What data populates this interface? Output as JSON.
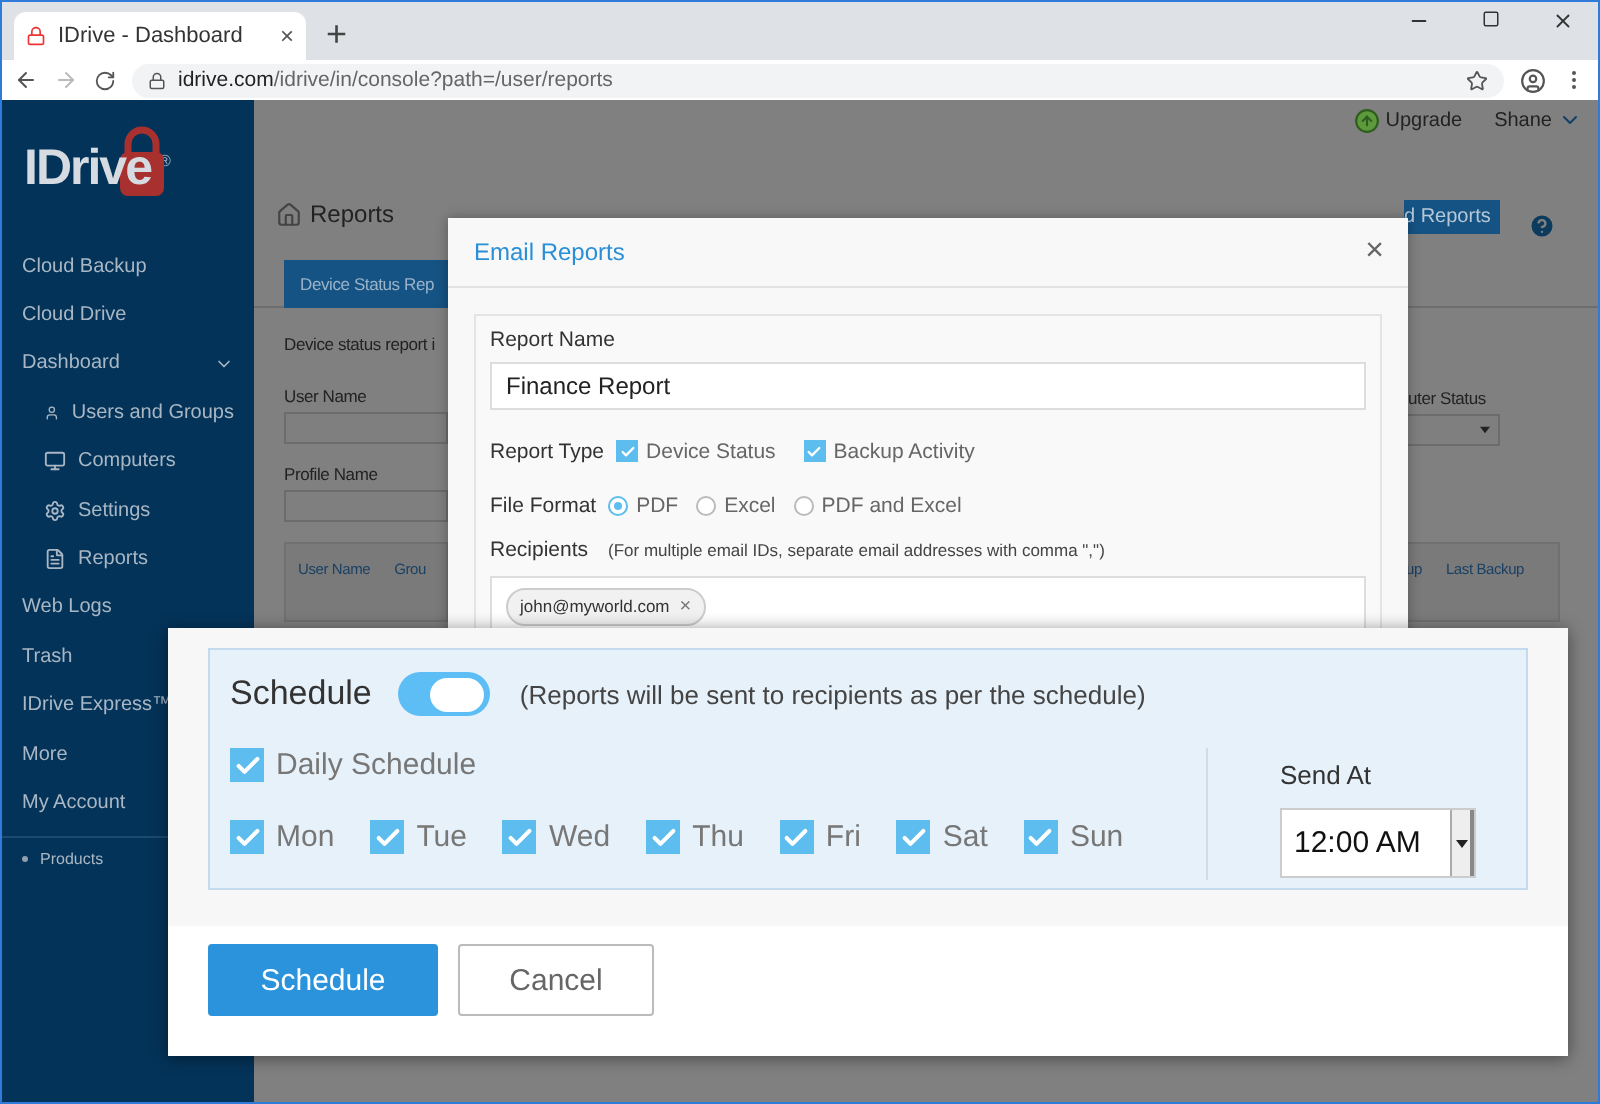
{
  "browser": {
    "tab": {
      "title": "IDrive - Dashboard",
      "close": "×"
    },
    "new_tab": "+",
    "url": {
      "host": "idrive.com",
      "path": "/idrive/in/console?path=/user/reports"
    }
  },
  "sidebar": {
    "logo": {
      "text": "IDrive",
      "mark": "®"
    },
    "items": [
      {
        "label": "Cloud Backup"
      },
      {
        "label": "Cloud Drive"
      },
      {
        "label": "Dashboard",
        "expanded": true,
        "children": [
          {
            "label": "Users and Groups"
          },
          {
            "label": "Computers"
          },
          {
            "label": "Settings"
          },
          {
            "label": "Reports"
          }
        ]
      },
      {
        "label": "Web Logs"
      },
      {
        "label": "Trash"
      },
      {
        "label": "IDrive Express™"
      },
      {
        "label": "More"
      },
      {
        "label": "My Account"
      }
    ],
    "footer": "Products"
  },
  "topbar": {
    "upgrade": "Upgrade",
    "user": "Shane"
  },
  "page": {
    "title": "Reports",
    "tab": "Device Status Rep",
    "description": "Device status report i",
    "fields_left": [
      "User Name",
      "Profile Name"
    ],
    "field_right": "uter Status",
    "columns_left": [
      "User Name",
      "Grou"
    ],
    "columns_right": [
      "up",
      "Last Backup"
    ],
    "button": "d Reports"
  },
  "modal": {
    "title": "Email Reports",
    "close": "×",
    "report_name_label": "Report Name",
    "report_name": "Finance Report",
    "report_type_label": "Report Type",
    "report_types": [
      {
        "label": "Device Status",
        "checked": true
      },
      {
        "label": "Backup Activity",
        "checked": true
      }
    ],
    "file_format_label": "File Format",
    "formats": [
      {
        "label": "PDF",
        "selected": true
      },
      {
        "label": "Excel",
        "selected": false
      },
      {
        "label": "PDF and Excel",
        "selected": false
      }
    ],
    "recipients_label": "Recipients",
    "recipients_note": "(For multiple email IDs, separate email addresses with comma \",\")",
    "recipients": [
      {
        "email": "john@myworld.com",
        "remove": "×"
      }
    ]
  },
  "schedule": {
    "label": "Schedule",
    "enabled": true,
    "note": "(Reports will be sent to recipients as per the schedule)",
    "daily": {
      "label": "Daily Schedule",
      "checked": true
    },
    "days": [
      {
        "label": "Mon",
        "checked": true
      },
      {
        "label": "Tue",
        "checked": true
      },
      {
        "label": "Wed",
        "checked": true
      },
      {
        "label": "Thu",
        "checked": true
      },
      {
        "label": "Fri",
        "checked": true
      },
      {
        "label": "Sat",
        "checked": true
      },
      {
        "label": "Sun",
        "checked": true
      }
    ],
    "send_at_label": "Send At",
    "send_at": "12:00 AM",
    "buttons": [
      {
        "label": "Schedule",
        "kind": "primary"
      },
      {
        "label": "Cancel",
        "kind": "secondary"
      }
    ]
  }
}
